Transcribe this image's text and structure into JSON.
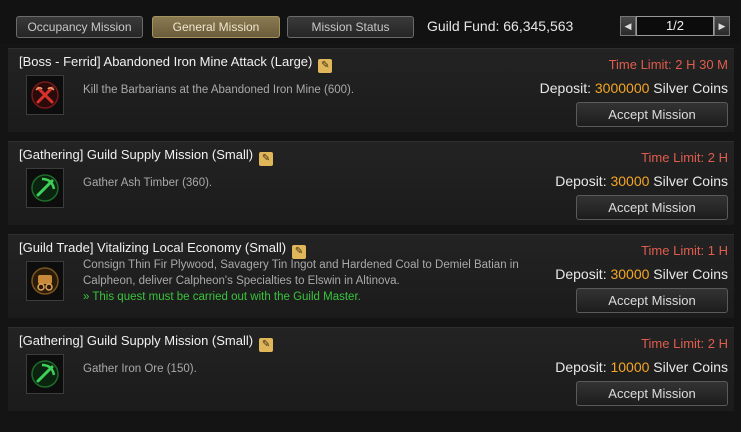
{
  "tabs": {
    "occupancy": "Occupancy Mission",
    "general": "General Mission",
    "status": "Mission Status"
  },
  "guild_fund": "Guild Fund: 66,345,563",
  "pager": {
    "prev": "◀",
    "next": "▶",
    "page": "1/2"
  },
  "missions": [
    {
      "title": "[Boss - Ferrid] Abandoned Iron Mine Attack (Large)",
      "description": "Kill the Barbarians at the Abandoned Iron Mine (600).",
      "time_limit": "Time Limit: 2 H 30 M",
      "deposit_prefix": "Deposit: ",
      "deposit_amount": "3000000",
      "deposit_suffix": " Silver Coins",
      "button": "Accept Mission",
      "icon": "boss-crossed-axes-icon"
    },
    {
      "title": "[Gathering] Guild Supply Mission (Small)",
      "description": "Gather Ash Timber (360).",
      "time_limit": "Time Limit: 2 H",
      "deposit_prefix": "Deposit: ",
      "deposit_amount": "30000",
      "deposit_suffix": " Silver Coins",
      "button": "Accept Mission",
      "icon": "gathering-pickaxe-icon"
    },
    {
      "title": "[Guild Trade] Vitalizing Local Economy (Small)",
      "description_line1": "Consign Thin Fir Plywood, Savagery Tin Ingot and Hardened Coal to Demiel Batian in",
      "description_line2": "Calpheon, deliver Calpheon's Specialties to Elswin in Altinova.",
      "note": "» This quest must be carried out with the Guild Master.",
      "time_limit": "Time Limit: 1 H",
      "deposit_prefix": "Deposit: ",
      "deposit_amount": "30000",
      "deposit_suffix": " Silver Coins",
      "button": "Accept Mission",
      "icon": "trade-wagon-icon"
    },
    {
      "title": "[Gathering] Guild Supply Mission (Small)",
      "description": "Gather Iron Ore (150).",
      "time_limit": "Time Limit: 2 H",
      "deposit_prefix": "Deposit: ",
      "deposit_amount": "10000",
      "deposit_suffix": " Silver Coins",
      "button": "Accept Mission",
      "icon": "gathering-pickaxe-icon"
    }
  ],
  "colors": {
    "time_limit": "#e05d4e",
    "deposit_amount": "#f5a623",
    "guild_master_note": "#39c43c",
    "active_tab": "#8a7a52"
  }
}
